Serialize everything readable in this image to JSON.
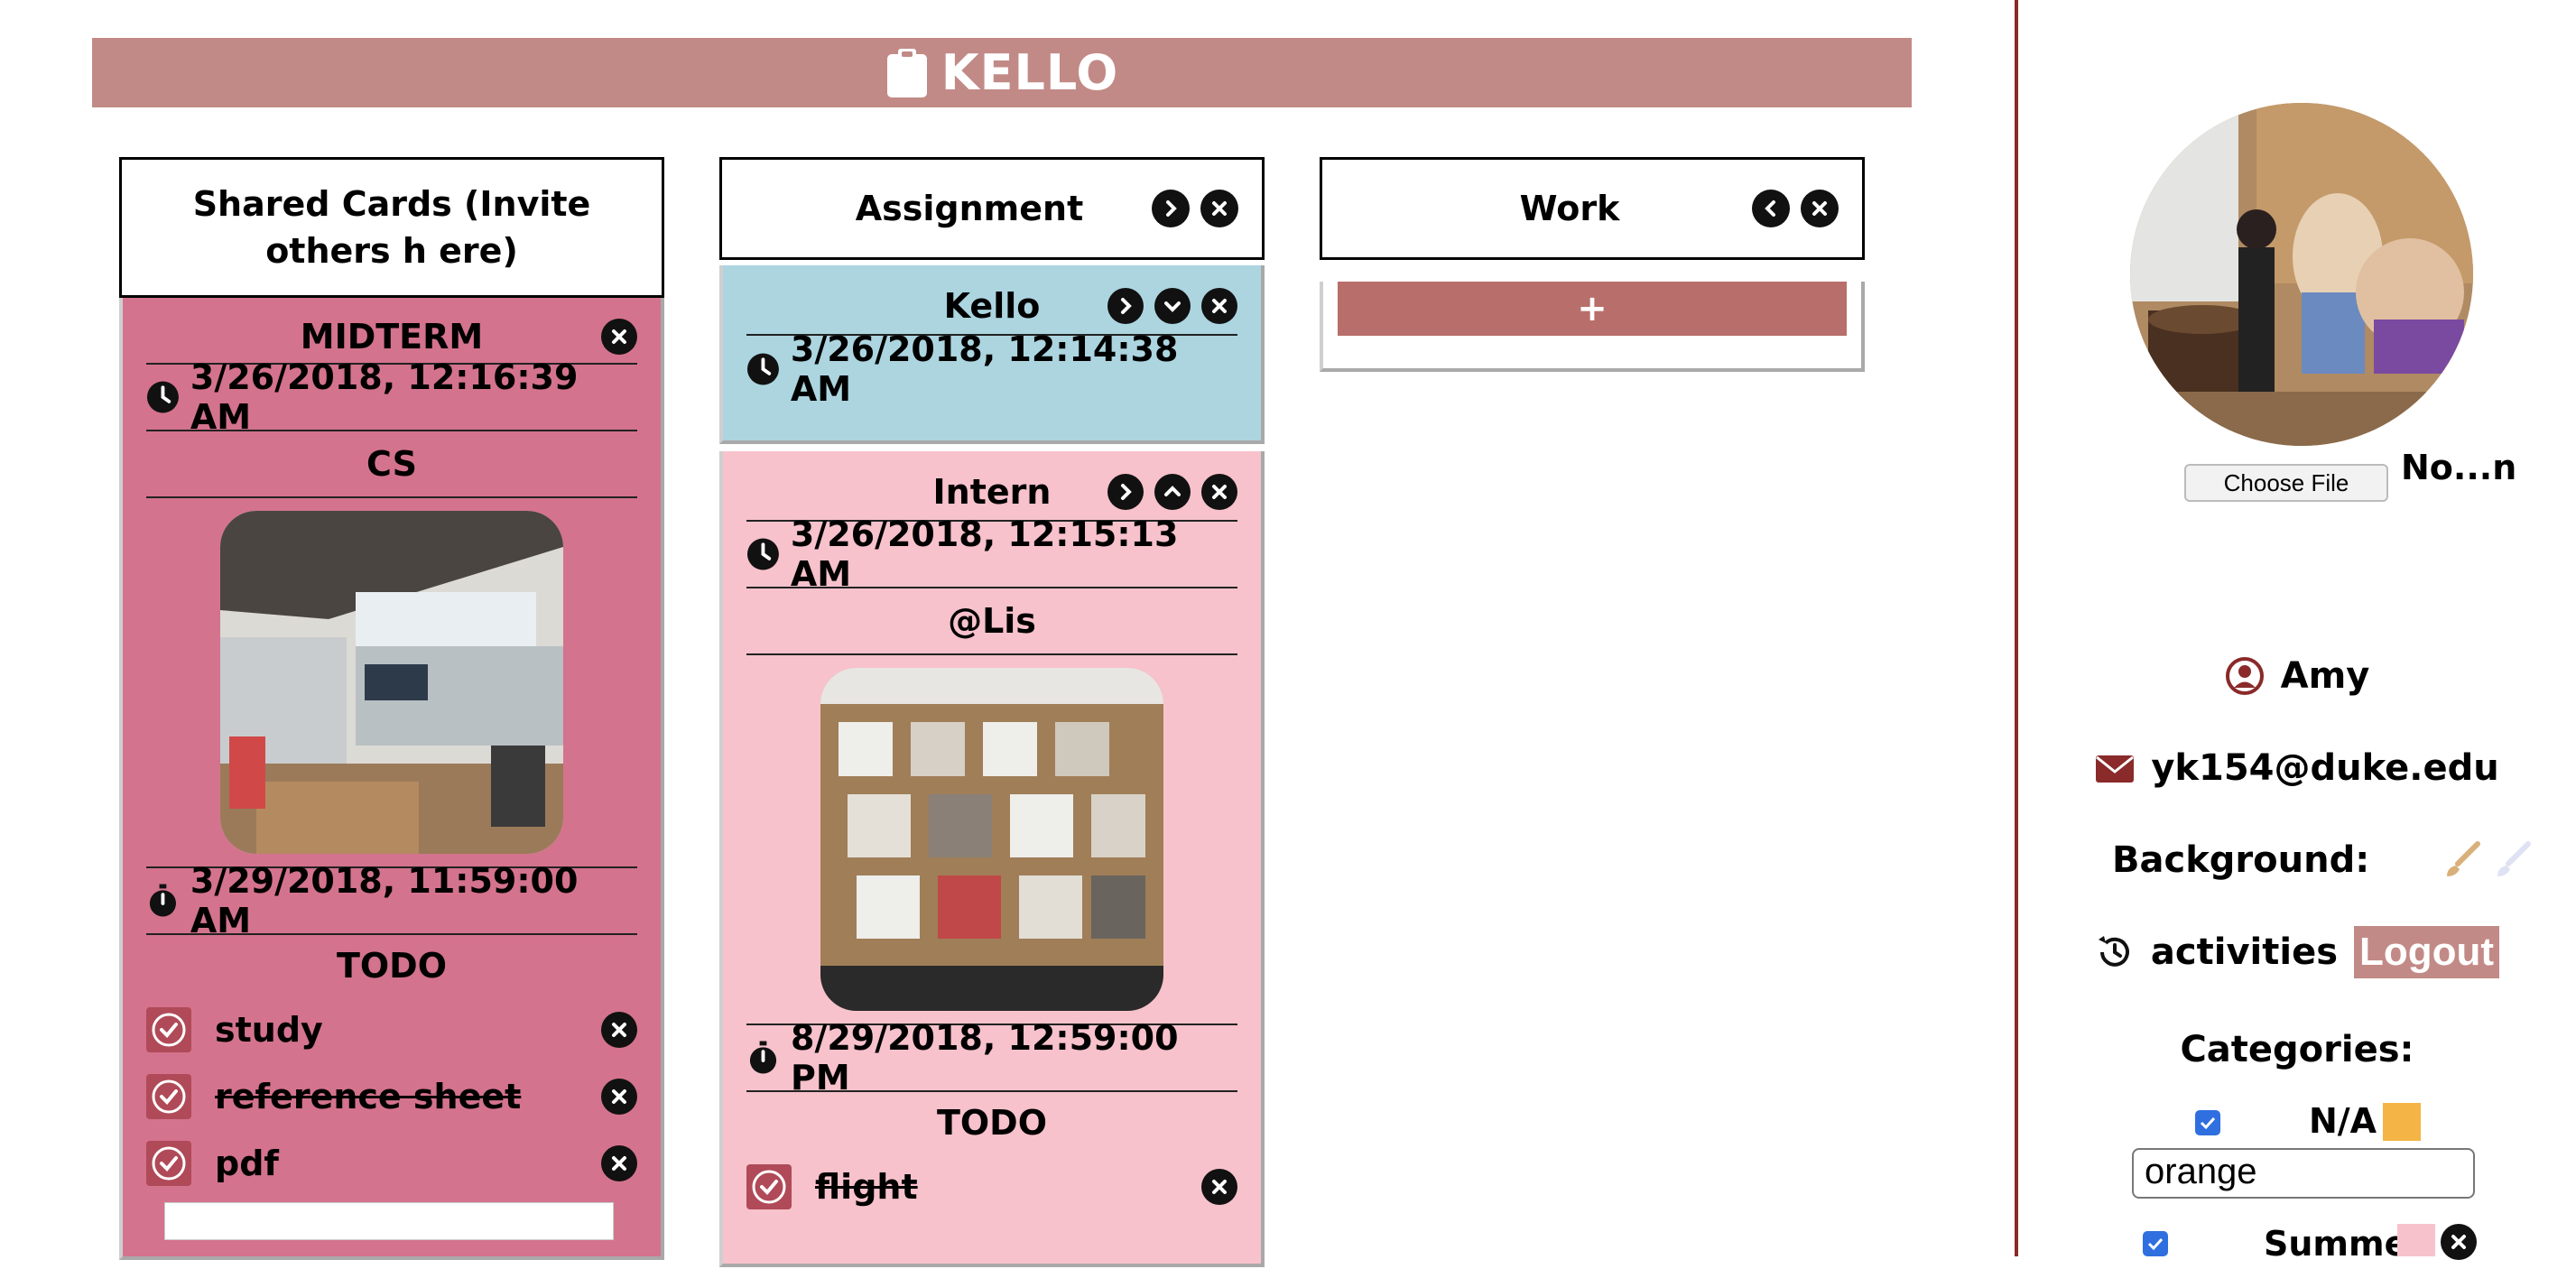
{
  "app": {
    "title": "KELLO",
    "accent": "#c28a86",
    "divider_color": "#8a2a2a"
  },
  "columns": [
    {
      "title": "Shared Cards (Invite others h ere)",
      "cards": [
        {
          "color": "#d4738d",
          "title": "MIDTERM",
          "created": "3/26/2018, 12:16:39 AM",
          "category": "CS",
          "due": "3/29/2018, 11:59:00 AM",
          "todo_label": "TODO",
          "todos": [
            {
              "text": "study",
              "done": false
            },
            {
              "text": "reference sheet",
              "done": true
            },
            {
              "text": "pdf",
              "done": false
            }
          ]
        }
      ]
    },
    {
      "title": "Assignment",
      "cards": [
        {
          "color": "#acd5e0",
          "title": "Kello",
          "created": "3/26/2018, 12:14:38 AM"
        },
        {
          "color": "#f7c2cc",
          "title": "Intern",
          "created": "3/26/2018, 12:15:13 AM",
          "assignee": "@Lis",
          "due": "8/29/2018, 12:59:00 PM",
          "todo_label": "TODO",
          "todos": [
            {
              "text": "flight",
              "done": true
            }
          ]
        }
      ]
    },
    {
      "title": "Work",
      "add_label": "+"
    }
  ],
  "sidebar": {
    "file_button": "Choose File",
    "file_name": "No...n",
    "user_name": "Amy",
    "email": "yk154@duke.edu",
    "background_label": "Background:",
    "activities_label": "activities",
    "logout_label": "Logout",
    "categories_label": "Categories:",
    "categories": [
      {
        "name": "N/A",
        "color": "#f4b446",
        "checked": true
      },
      {
        "name": "Summer",
        "color": "#f7c2cc",
        "checked": true
      }
    ],
    "category_input_value": "orange"
  }
}
